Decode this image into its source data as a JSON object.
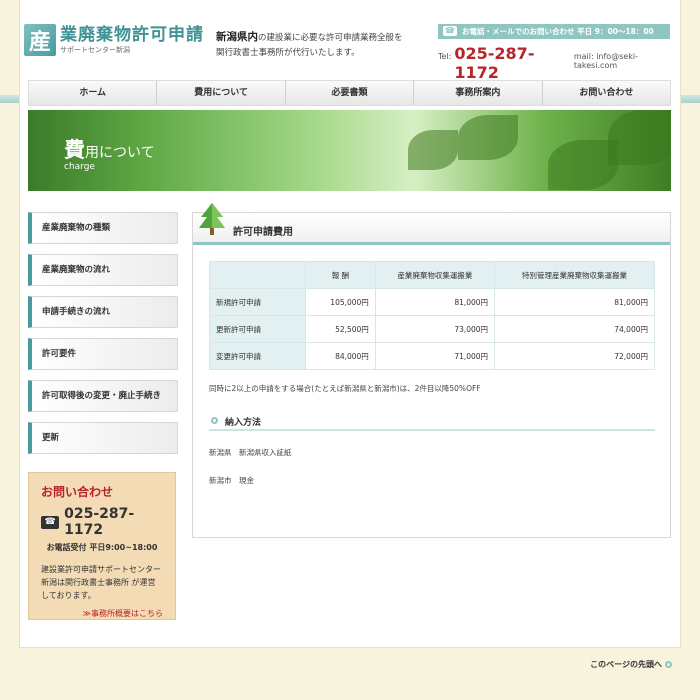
{
  "header": {
    "logo_mark": "産",
    "logo_title": "業廃棄物許可申請",
    "logo_sub": "サポートセンター新潟",
    "tagline_bold": "新潟県内",
    "tagline_rest1": "の建設業に必要な許可申請業務全般を",
    "tagline_line2": "関行政書士事務所が代行いたします。",
    "contact_strip": "お電話・メールでのお問い合わせ 平日 9：00～18：00",
    "phone_icon": "☎",
    "tel_label": "Tel:",
    "tel_number": "025-287-1172",
    "mail": "mail: info@seki-takesi.com"
  },
  "nav": {
    "items": [
      "ホーム",
      "費用について",
      "必要書類",
      "事務所案内",
      "お問い合わせ"
    ]
  },
  "hero": {
    "title_big": "費",
    "title_rest": "用について",
    "title_en": "charge"
  },
  "sidebar": {
    "items": [
      "産業廃棄物の種類",
      "産業廃棄物の流れ",
      "申請手続きの流れ",
      "許可要件",
      "許可取得後の変更・廃止手続き",
      "更新"
    ],
    "contact": {
      "title": "お問い合わせ",
      "phone_icon": "☎",
      "number": "025-287-1172",
      "hours": "お電話受付 平日9:00~18:00",
      "desc": "建設業許可申請サポートセンター新潟は関行政書士事務所 が運営しております。",
      "link": "≫事務所概要はこちら"
    }
  },
  "main": {
    "title": "許可申請費用",
    "table": {
      "headers": [
        "",
        "報 酬",
        "産業廃棄物収集運搬業",
        "特別管理産業廃棄物収集運搬業"
      ],
      "rows": [
        [
          "新規許可申請",
          "105,000円",
          "81,000円",
          "81,000円"
        ],
        [
          "更新許可申請",
          "52,500円",
          "73,000円",
          "74,000円"
        ],
        [
          "変更許可申請",
          "84,000円",
          "71,000円",
          "72,000円"
        ]
      ]
    },
    "note": "同時に2以上の申請をする場合(たとえば新潟県と新潟市)は、2件目以降50%OFF",
    "payment_heading": "納入方法",
    "payment_lines": [
      "新潟県　新潟県収入証紙",
      "新潟市　現金"
    ]
  },
  "footer": {
    "pagetop": "このページの先頭へ"
  }
}
